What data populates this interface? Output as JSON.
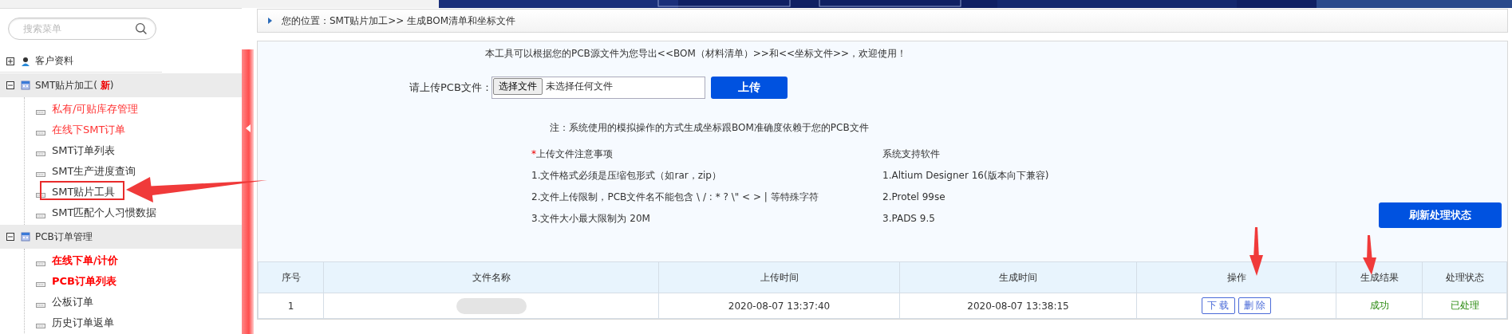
{
  "sidebar": {
    "search": {
      "placeholder": "搜索菜单"
    },
    "groups": [
      {
        "label": "客户资料",
        "expanded": false
      },
      {
        "label": "SMT贴片加工( **新**)",
        "expanded": true,
        "items": [
          {
            "label": "私有/可贴库存管理",
            "color": "#ff3333",
            "bold": false
          },
          {
            "label": "在线下SMT订单",
            "color": "#ff3333",
            "bold": false
          },
          {
            "label": "SMT订单列表",
            "color": "#333333",
            "bold": false
          },
          {
            "label": "SMT生产进度查询",
            "color": "#333333",
            "bold": false
          },
          {
            "label": "SMT贴片工具",
            "color": "#333333",
            "bold": false
          },
          {
            "label": "SMT匹配个人习惯数据",
            "color": "#333333",
            "bold": false
          }
        ]
      },
      {
        "label": "PCB订单管理",
        "expanded": true,
        "items": [
          {
            "label": "在线下单/计价",
            "color": "#ff0000",
            "bold": true
          },
          {
            "label": "PCB订单列表",
            "color": "#ff0000",
            "bold": true
          },
          {
            "label": "公板订单",
            "color": "#333333",
            "bold": false
          },
          {
            "label": "历史订单返单",
            "color": "#333333",
            "bold": false
          }
        ]
      }
    ]
  },
  "breadcrumb": "您的位置：SMT贴片加工>> 生成BOM清单和坐标文件",
  "intro": "本工具可以根据您的PCB源文件为您导出<<BOM（材料清单）>>和<<坐标文件>>，欢迎使用！",
  "upload": {
    "label": "请上传PCB文件：",
    "choose_button": "选择文件",
    "file_status": "未选择任何文件",
    "submit": "上传"
  },
  "note": "注：系统使用的模拟操作的方式生成坐标跟BOM准确度依赖于您的PCB文件",
  "upload_notes": {
    "title": "上传文件注意事项",
    "required_mark": "*",
    "items": [
      "1.文件格式必须是压缩包形式（如rar，zip）",
      "2.文件上传限制，PCB文件名不能包含 \\ / : * ? \\\" < > | 等特殊字符",
      "3.文件大小最大限制为 20M"
    ]
  },
  "supported_software": {
    "title": "系统支持软件",
    "items": [
      "1.Altium Designer 16(版本向下兼容)",
      "2.Protel 99se",
      "3.PADS 9.5"
    ]
  },
  "refresh_button": "刷新处理状态",
  "table": {
    "columns": [
      "序号",
      "文件名称",
      "上传时间",
      "生成时间",
      "操作",
      "生成结果",
      "处理状态"
    ],
    "rows": [
      {
        "index": "1",
        "file_blurred": true,
        "uploaded": "2020-08-07 13:37:40",
        "generated": "2020-08-07 13:38:15",
        "actions": [
          "下 载",
          "删 除"
        ],
        "result": "成功",
        "status": "已处理"
      }
    ]
  }
}
